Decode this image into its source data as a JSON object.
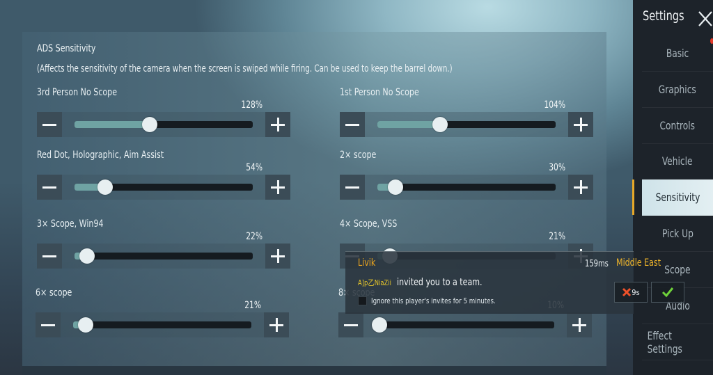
{
  "header": {
    "title": "ADS Sensitivity",
    "description": "(Affects the sensitivity of the camera when the screen is swiped while firing. Can be used to keep the barrel down.)"
  },
  "sliders": [
    {
      "label": "3rd Person No Scope",
      "value_text": "128%",
      "fraction": 0.42
    },
    {
      "label": "1st Person No Scope",
      "value_text": "104%",
      "fraction": 0.35
    },
    {
      "label": "Red Dot, Holographic, Aim Assist",
      "value_text": "54%",
      "fraction": 0.17
    },
    {
      "label": "2× scope",
      "value_text": "30%",
      "fraction": 0.1
    },
    {
      "label": "3× Scope, Win94",
      "value_text": "22%",
      "fraction": 0.07
    },
    {
      "label": "4× Scope, VSS",
      "value_text": "21%",
      "fraction": 0.07
    },
    {
      "label": "6× scope",
      "value_text": "21%",
      "fraction": 0.07
    },
    {
      "label": "8× scope",
      "value_text": "10%",
      "fraction": 0.02
    }
  ],
  "sidebar": {
    "title": "Settings",
    "close_icon": "close-icon",
    "items": [
      {
        "label": "Basic"
      },
      {
        "label": "Graphics"
      },
      {
        "label": "Controls"
      },
      {
        "label": "Vehicle"
      },
      {
        "label": "Sensitivity",
        "active": true
      },
      {
        "label": "Pick Up"
      },
      {
        "label": "Scope"
      },
      {
        "label": "Audio"
      },
      {
        "label": "Effect Settings"
      }
    ]
  },
  "invite": {
    "map": "Livik",
    "ping": "159ms",
    "region": "Middle East",
    "player": "A]p乙NiaZii",
    "message": "invited you to a team.",
    "ignore_label": "Ignore this player's invites for 5 minutes.",
    "decline_countdown": "9s"
  },
  "colors": {
    "accent": "#e8a928",
    "invite_map": "#f0a71d",
    "decline": "#f0522a",
    "accept": "#6fd23a"
  }
}
